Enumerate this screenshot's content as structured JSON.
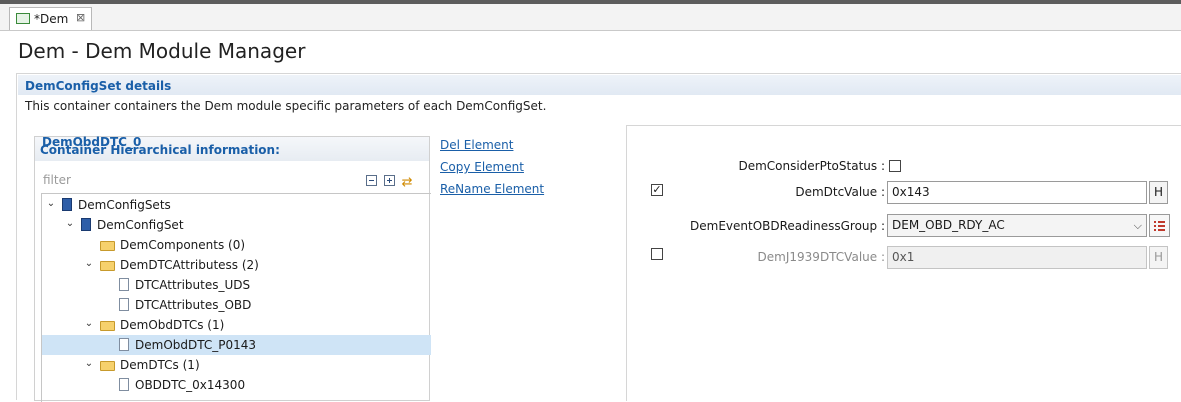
{
  "tab": {
    "label": "*Dem",
    "close": "⊠"
  },
  "page": {
    "title": "Dem - Dem Module Manager"
  },
  "section": {
    "title": "DemConfigSet details",
    "description": "This container containers the Dem module specific parameters of each DemConfigSet."
  },
  "hierarchy": {
    "title": "Container Hierarchical information:",
    "filter_placeholder": "filter",
    "rows": [
      {
        "label": "DemConfigSets",
        "toggle": "v",
        "icon": "module-icon"
      },
      {
        "label": "DemConfigSet",
        "toggle": "v",
        "icon": "module-icon"
      },
      {
        "label": "DemComponents (0)",
        "toggle": "",
        "icon": "folder-icon"
      },
      {
        "label": "DemDTCAttributess (2)",
        "toggle": "v",
        "icon": "folder-icon"
      },
      {
        "label": "DTCAttributes_UDS",
        "toggle": "",
        "icon": "document-icon"
      },
      {
        "label": "DTCAttributes_OBD",
        "toggle": "",
        "icon": "document-icon"
      },
      {
        "label": "DemObdDTCs (1)",
        "toggle": "v",
        "icon": "folder-icon"
      },
      {
        "label": "DemObdDTC_P0143",
        "toggle": "",
        "icon": "document-icon",
        "selected": true
      },
      {
        "label": "DemDTCs (1)",
        "toggle": "v",
        "icon": "folder-icon"
      },
      {
        "label": "OBDDTC_0x14300",
        "toggle": "",
        "icon": "document-icon"
      }
    ]
  },
  "actions": {
    "delete": "Del Element",
    "copy": "Copy Element",
    "rename": "ReName Element"
  },
  "details": {
    "title": "DemObdDTC_0",
    "consider_pto": {
      "label": "DemConsiderPtoStatus :",
      "checked": false
    },
    "dtc_value": {
      "label": "DemDtcValue :",
      "value": "0x143",
      "enabled": true,
      "hex_button": "H"
    },
    "readiness_group": {
      "label": "DemEventOBDReadinessGroup :",
      "value": "DEM_OBD_RDY_AC"
    },
    "j1939": {
      "label": "DemJ1939DTCValue :",
      "value": "0x1",
      "enabled": false,
      "hex_button": "H"
    }
  },
  "colors": {
    "accent": "#1a5fa8",
    "selection": "#cfe4f6"
  }
}
